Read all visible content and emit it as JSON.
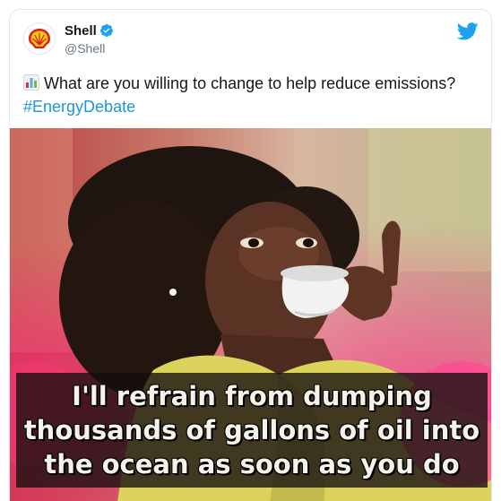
{
  "tweet": {
    "display_name": "Shell",
    "handle": "@Shell",
    "text": "What are you willing to change to help reduce emissions?",
    "hashtag": "#EnergyDebate",
    "text_emoji": "bar-chart-emoji"
  },
  "icons": {
    "avatar": "shell-logo-icon",
    "verified": "verified-badge-icon",
    "platform": "twitter-bird-icon"
  },
  "media": {
    "caption_lines": [
      "I'll refrain from dumping",
      "thousands of gallons of oil into",
      "the ocean as soon as you do"
    ]
  },
  "colors": {
    "text": "#14171a",
    "secondary_text": "#657786",
    "link": "#1b95e0",
    "twitter_blue": "#1da1f2",
    "shell_yellow": "#fbce07",
    "shell_red": "#dd1d21"
  }
}
